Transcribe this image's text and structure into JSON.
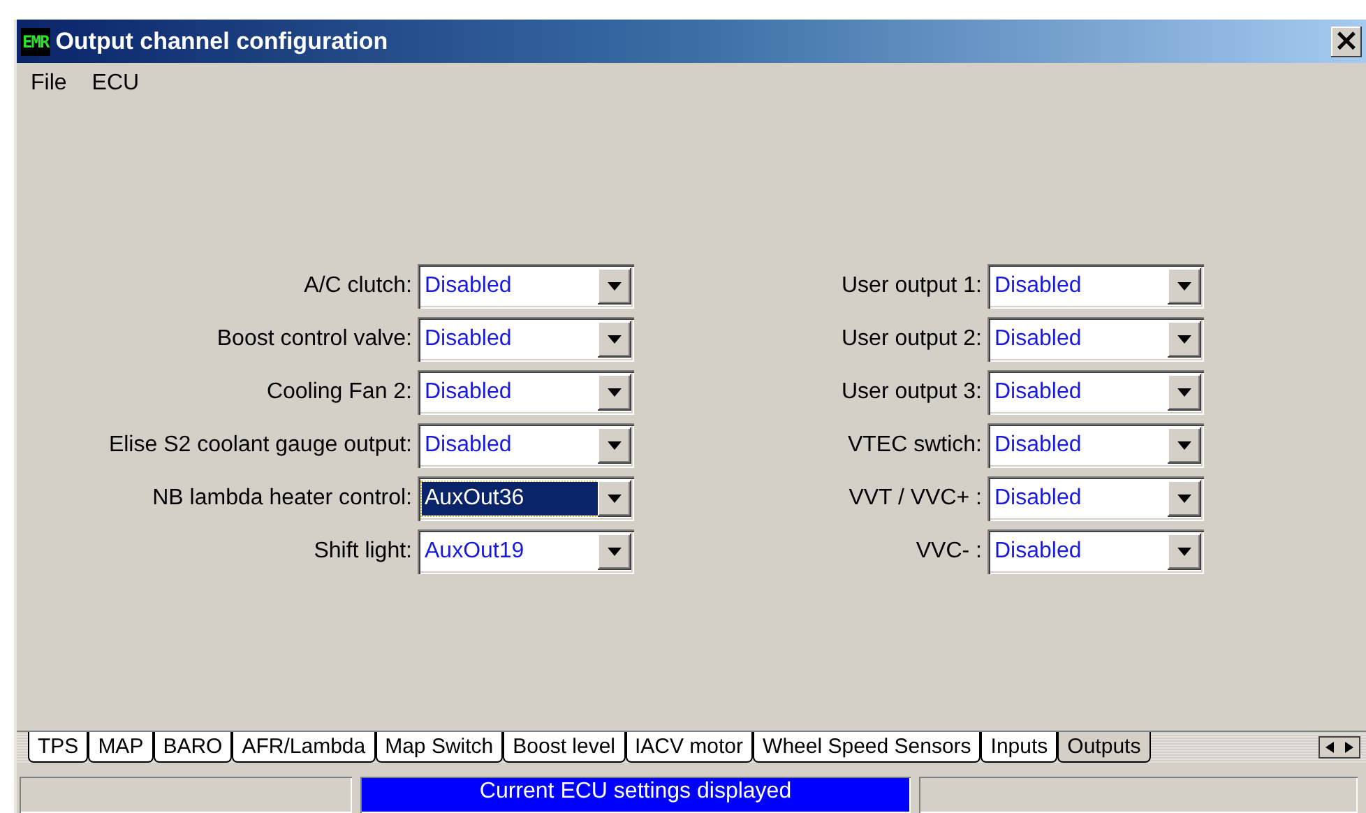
{
  "window": {
    "icon_text": "EMR",
    "title": "Output channel configuration",
    "close": "×"
  },
  "menu": [
    "File",
    "ECU"
  ],
  "outputs_left": [
    {
      "label": "A/C clutch:",
      "value": "Disabled",
      "focused": false
    },
    {
      "label": "Boost control valve:",
      "value": "Disabled",
      "focused": false
    },
    {
      "label": "Cooling Fan 2:",
      "value": "Disabled",
      "focused": false
    },
    {
      "label": "Elise S2 coolant gauge output:",
      "value": "Disabled",
      "focused": false
    },
    {
      "label": "NB lambda heater control:",
      "value": "AuxOut36",
      "focused": true
    },
    {
      "label": "Shift light:",
      "value": "AuxOut19",
      "focused": false
    }
  ],
  "outputs_right": [
    {
      "label": "User output 1:",
      "value": "Disabled",
      "focused": false
    },
    {
      "label": "User output 2:",
      "value": "Disabled",
      "focused": false
    },
    {
      "label": "User output 3:",
      "value": "Disabled",
      "focused": false
    },
    {
      "label": "VTEC swtich:",
      "value": "Disabled",
      "focused": false
    },
    {
      "label": "VVT / VVC+ :",
      "value": "Disabled",
      "focused": false
    },
    {
      "label": "VVC- :",
      "value": "Disabled",
      "focused": false
    }
  ],
  "tabs": [
    {
      "label": "TPS",
      "selected": false
    },
    {
      "label": "MAP",
      "selected": false
    },
    {
      "label": "BARO",
      "selected": false
    },
    {
      "label": "AFR/Lambda",
      "selected": false
    },
    {
      "label": "Map Switch",
      "selected": false
    },
    {
      "label": "Boost level",
      "selected": false
    },
    {
      "label": "IACV motor",
      "selected": false
    },
    {
      "label": "Wheel Speed Sensors",
      "selected": false
    },
    {
      "label": "Inputs",
      "selected": false
    },
    {
      "label": "Outputs",
      "selected": true
    }
  ],
  "status_bar": {
    "message": "Current ECU settings displayed"
  }
}
